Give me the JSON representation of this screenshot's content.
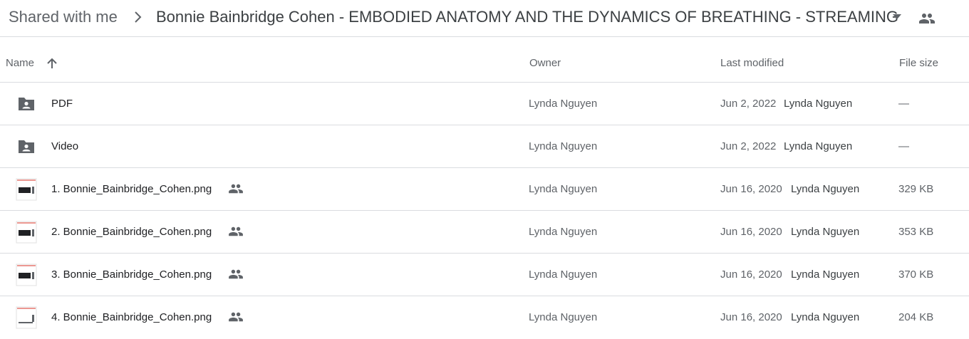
{
  "breadcrumb": {
    "root": "Shared with me",
    "current": "Bonnie Bainbridge Cohen - EMBODIED ANATOMY AND THE DYNAMICS OF BREATHING - STREAMING"
  },
  "columns": {
    "name": "Name",
    "owner": "Owner",
    "last_modified": "Last modified",
    "file_size": "File size"
  },
  "rows": [
    {
      "name": "PDF",
      "type": "folder",
      "owner": "Lynda Nguyen",
      "modified_date": "Jun 2, 2022",
      "modified_by": "Lynda Nguyen",
      "size": "—"
    },
    {
      "name": "Video",
      "type": "folder",
      "owner": "Lynda Nguyen",
      "modified_date": "Jun 2, 2022",
      "modified_by": "Lynda Nguyen",
      "size": "—"
    },
    {
      "name": "1. Bonnie_Bainbridge_Cohen.png",
      "type": "image",
      "owner": "Lynda Nguyen",
      "modified_date": "Jun 16, 2020",
      "modified_by": "Lynda Nguyen",
      "size": "329 KB"
    },
    {
      "name": "2. Bonnie_Bainbridge_Cohen.png",
      "type": "image",
      "owner": "Lynda Nguyen",
      "modified_date": "Jun 16, 2020",
      "modified_by": "Lynda Nguyen",
      "size": "353 KB"
    },
    {
      "name": "3. Bonnie_Bainbridge_Cohen.png",
      "type": "image",
      "owner": "Lynda Nguyen",
      "modified_date": "Jun 16, 2020",
      "modified_by": "Lynda Nguyen",
      "size": "370 KB"
    },
    {
      "name": "4. Bonnie_Bainbridge_Cohen.png",
      "type": "image",
      "owner": "Lynda Nguyen",
      "modified_date": "Jun 16, 2020",
      "modified_by": "Lynda Nguyen",
      "size": "204 KB"
    }
  ],
  "icons": {
    "breadcrumb_separator": "chevron-right-icon",
    "dropdown": "caret-down-icon",
    "shared_drive": "people-icon",
    "sort": "arrow-up-icon",
    "folder": "shared-folder-icon",
    "shared": "people-icon"
  },
  "colors": {
    "text_primary": "#202124",
    "text_secondary": "#5f6368",
    "divider": "#dadce0",
    "icon": "#5f6368"
  }
}
